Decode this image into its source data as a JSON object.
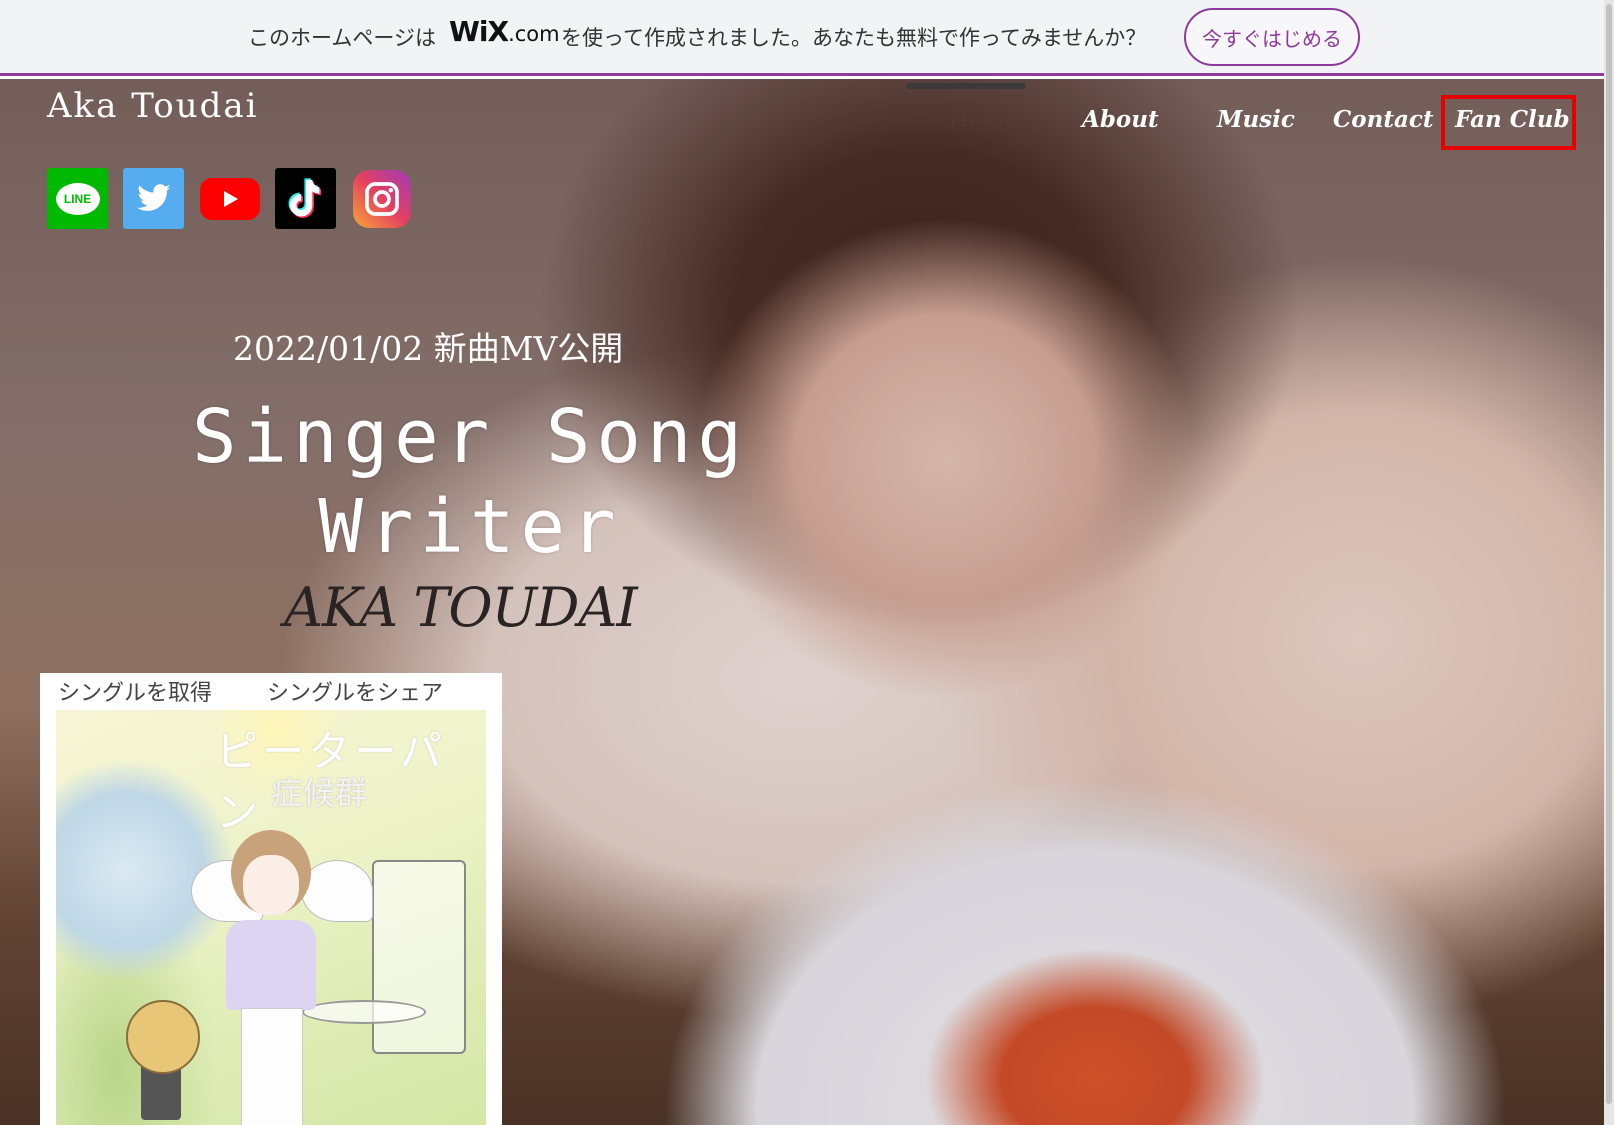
{
  "wix_banner": {
    "text_before": "このホームページは",
    "logo_main": "WiX",
    "logo_suffix": ".com",
    "text_after": "を使って作成されました。あなたも無料で作ってみませんか？",
    "cta_label": "今すぐはじめる",
    "accent_color": "#8e3a9c"
  },
  "site": {
    "title": "Aka Toudai"
  },
  "socials": [
    {
      "name": "line-icon",
      "label": "LINE"
    },
    {
      "name": "twitter-icon"
    },
    {
      "name": "youtube-icon"
    },
    {
      "name": "tiktok-icon"
    },
    {
      "name": "instagram-icon"
    }
  ],
  "nav": {
    "items": [
      {
        "label": "Home",
        "state": "active"
      },
      {
        "label": "About"
      },
      {
        "label": "Music"
      },
      {
        "label": "Contact"
      },
      {
        "label": "Fan Club",
        "highlighted": true
      }
    ],
    "highlight_color": "#e60000"
  },
  "hero": {
    "announcement": "2022/01/02 新曲MV公開",
    "headline_line1": "Singer Song",
    "headline_line2": "Writer",
    "artist_name": "AKA TOUDAI"
  },
  "single": {
    "get_link": "シングルを取得",
    "share_link": "シングルをシェア",
    "cover_title": "ピーターパン",
    "cover_subtitle": "症候群"
  }
}
